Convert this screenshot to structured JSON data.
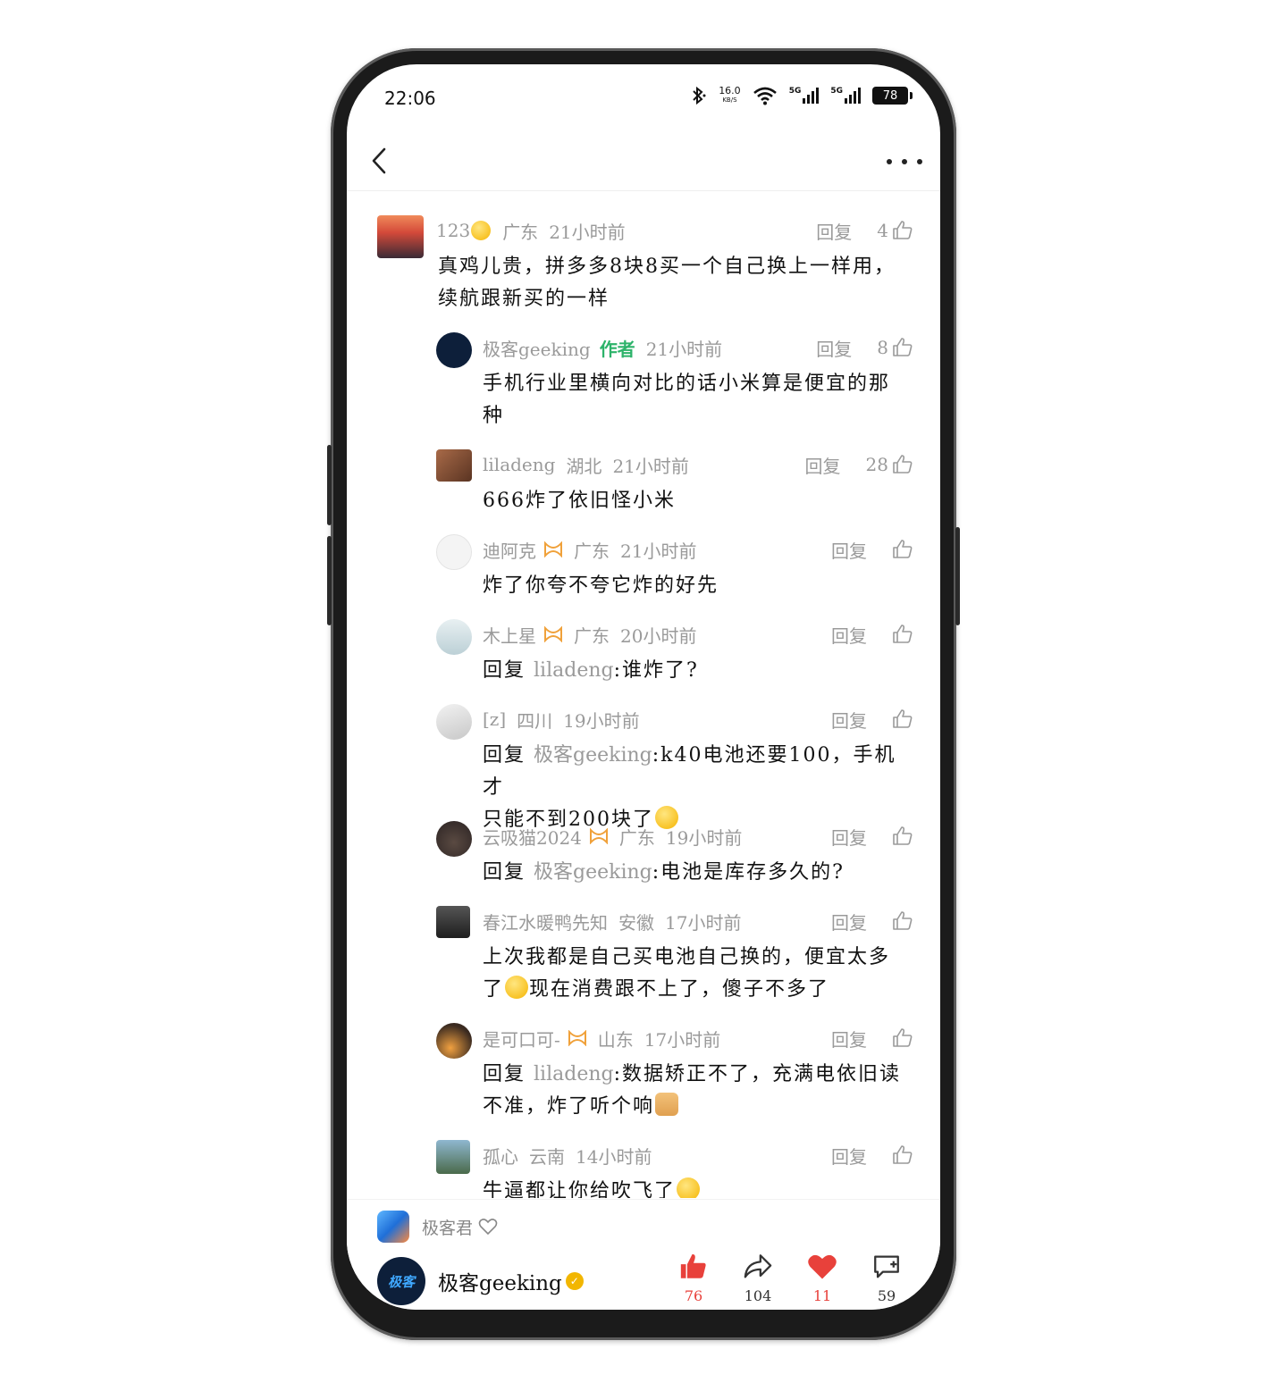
{
  "status_bar": {
    "time": "22:06",
    "net_speed": "16.0",
    "net_speed_unit": "KB/S",
    "signal_1": "5G",
    "signal_2": "5G",
    "battery": "78"
  },
  "comments": [
    {
      "user": "123",
      "location": "广东",
      "time": "21小时前",
      "reply_label": "回复",
      "likes": "4",
      "text": [
        "真鸡儿贵，拼多多8块8买一个自己换上一样用，",
        "续航跟新买的一样"
      ]
    },
    {
      "user": "极客geeking",
      "author_tag": "作者",
      "time": "21小时前",
      "reply_label": "回复",
      "likes": "8",
      "text": [
        "手机行业里横向对比的话小米算是便宜的那",
        "种"
      ]
    },
    {
      "user": "liladeng",
      "location": "湖北",
      "time": "21小时前",
      "reply_label": "回复",
      "likes": "28",
      "text": [
        "666炸了依旧怪小米"
      ]
    },
    {
      "user": "迪阿克",
      "location": "广东",
      "time": "21小时前",
      "reply_label": "回复",
      "likes": "",
      "text": [
        "炸了你夸不夸它炸的好先"
      ]
    },
    {
      "user": "木上星",
      "location": "广东",
      "time": "20小时前",
      "reply_label": "回复",
      "likes": "",
      "reply_prefix": "回复",
      "reply_to": "liladeng",
      "text": [
        ":谁炸了?"
      ]
    },
    {
      "user": "[z]",
      "location": "四川",
      "time": "19小时前",
      "reply_label": "回复",
      "likes": "",
      "reply_prefix": "回复",
      "reply_to": "极客geeking",
      "text": [
        ":k40电池还要100，手机才",
        "只能不到200块了"
      ]
    },
    {
      "user": "云吸猫2024",
      "location": "广东",
      "time": "19小时前",
      "reply_label": "回复",
      "likes": "",
      "reply_prefix": "回复",
      "reply_to": "极客geeking",
      "text": [
        ":电池是库存多久的?"
      ]
    },
    {
      "user": "春江水暖鸭先知",
      "location": "安徽",
      "time": "17小时前",
      "reply_label": "回复",
      "likes": "",
      "text": [
        "上次我都是自己买电池自己换的，便宜太多",
        "现在消费跟不上了，傻子不多了"
      ],
      "text_line2_prefix": "了"
    },
    {
      "user": "是可口可-",
      "location": "山东",
      "time": "17小时前",
      "reply_label": "回复",
      "likes": "",
      "reply_prefix": "回复",
      "reply_to": "liladeng",
      "text": [
        ":数据矫正不了，充满电依旧读",
        "不准，炸了听个响"
      ]
    },
    {
      "user": "孤心",
      "location": "云南",
      "time": "14小时前",
      "reply_label": "回复",
      "likes": "",
      "text": [
        "牛逼都让你给吹飞了"
      ]
    }
  ],
  "bottom": {
    "topic_name": "极客君",
    "author_name": "极客geeking",
    "author_avatar_text": "极客",
    "verified_mark": "✓",
    "actions": [
      {
        "name": "like",
        "count": "76",
        "color": "#e8413b"
      },
      {
        "name": "share",
        "count": "104",
        "color": "#333333"
      },
      {
        "name": "favorite",
        "count": "11",
        "color": "#e8413b"
      },
      {
        "name": "comment",
        "count": "59",
        "color": "#333333"
      }
    ]
  },
  "colors": {
    "accent_red": "#e8413b",
    "author_green": "#2db36a",
    "meta_gray": "#9a9a9a"
  }
}
